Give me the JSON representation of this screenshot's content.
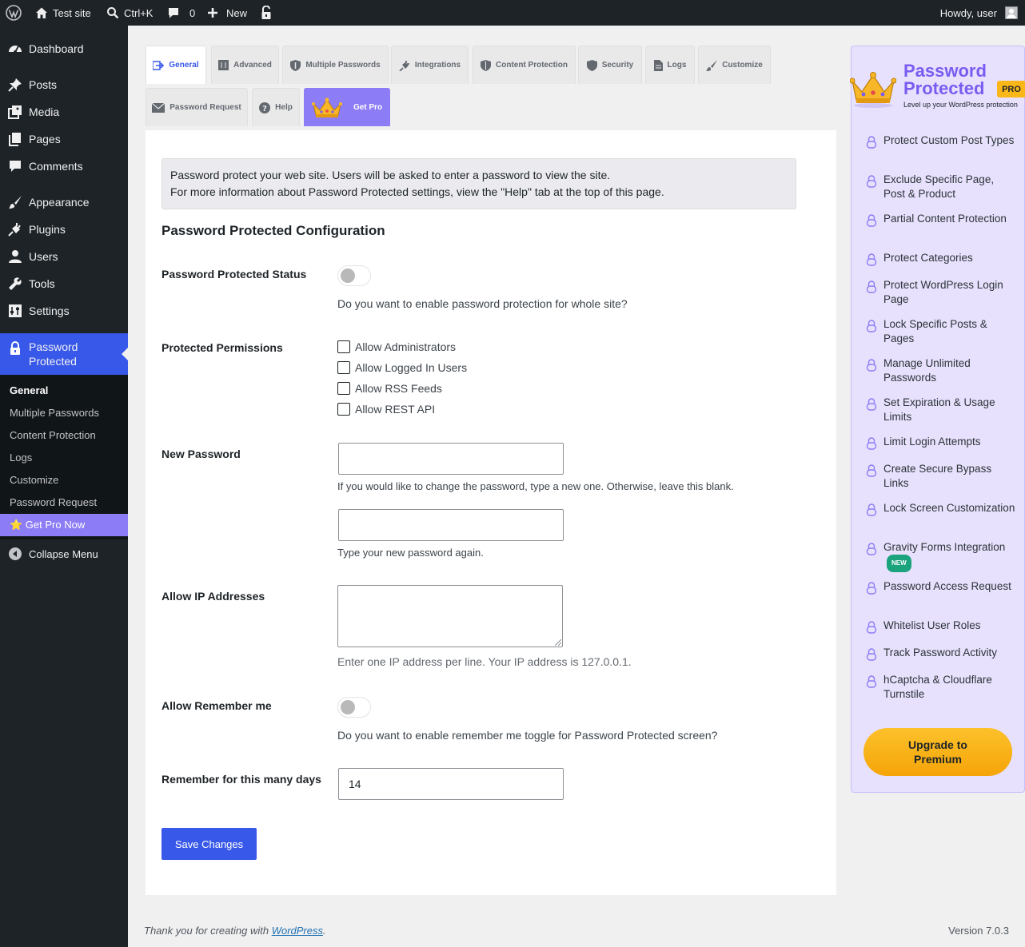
{
  "admin_bar": {
    "site_name": "Test site",
    "search_shortcut": "Ctrl+K",
    "comments_count": "0",
    "new_label": "New",
    "greeting": "Howdy, user"
  },
  "sidebar": {
    "items": [
      {
        "label": "Dashboard",
        "icon": "dashboard-icon"
      },
      {
        "label": "Posts",
        "icon": "pin-icon"
      },
      {
        "label": "Media",
        "icon": "media-icon"
      },
      {
        "label": "Pages",
        "icon": "pages-icon"
      },
      {
        "label": "Comments",
        "icon": "comment-icon"
      },
      {
        "label": "Appearance",
        "icon": "brush-icon"
      },
      {
        "label": "Plugins",
        "icon": "plug-icon"
      },
      {
        "label": "Users",
        "icon": "user-icon"
      },
      {
        "label": "Tools",
        "icon": "wrench-icon"
      },
      {
        "label": "Settings",
        "icon": "settings-icon"
      }
    ],
    "active_item": {
      "label_line1": "Password",
      "label_line2": "Protected",
      "icon": "lock-icon"
    },
    "submenu": [
      "General",
      "Multiple Passwords",
      "Content Protection",
      "Logs",
      "Customize",
      "Password Request"
    ],
    "get_pro": "⭐ Get Pro Now",
    "collapse": "Collapse Menu"
  },
  "tabs": {
    "row1": [
      "General",
      "Advanced",
      "Multiple Passwords",
      "Integrations",
      "Content Protection",
      "Security",
      "Logs",
      "Customize"
    ],
    "row2": [
      "Password Request",
      "Help",
      "Get Pro"
    ]
  },
  "notice": {
    "line1": "Password protect your web site. Users will be asked to enter a password to view the site.",
    "line2": "For more information about Password Protected settings, view the \"Help\" tab at the top of this page."
  },
  "config": {
    "heading": "Password Protected Configuration",
    "status_label": "Password Protected Status",
    "status_desc": "Do you want to enable password protection for whole site?",
    "permissions_label": "Protected Permissions",
    "permissions": [
      "Allow Administrators",
      "Allow Logged In Users",
      "Allow RSS Feeds",
      "Allow REST API"
    ],
    "new_password_label": "New Password",
    "new_password_desc": "If you would like to change the password, type a new one. Otherwise, leave this blank.",
    "confirm_password_desc": "Type your new password again.",
    "ip_label": "Allow IP Addresses",
    "ip_desc": "Enter one IP address per line. Your IP address is 127.0.0.1.",
    "remember_label": "Allow Remember me",
    "remember_desc": "Do you want to enable remember me toggle for Password Protected screen?",
    "days_label": "Remember for this many days",
    "days_value": "14",
    "save_label": "Save Changes"
  },
  "promo": {
    "title_line1": "Password",
    "title_line2": "Protected",
    "badge": "PRO",
    "subtitle": "Level up your WordPress protection",
    "features": [
      "Protect Custom Post Types",
      "Exclude Specific Page, Post & Product",
      "Partial Content Protection",
      "Protect Categories",
      "Protect WordPress Login Page",
      "Lock Specific Posts & Pages",
      "Manage Unlimited Passwords",
      "Set Expiration & Usage Limits",
      "Limit Login Attempts",
      "Create Secure Bypass Links",
      "Lock Screen Customization",
      "Gravity Forms Integration",
      "Password Access Request",
      "Whitelist User Roles",
      "Track Password Activity",
      "hCaptcha & Cloudflare Turnstile"
    ],
    "new_badge": "NEW",
    "upgrade_line1": "Upgrade to",
    "upgrade_line2": "Premium"
  },
  "footer": {
    "thanks_prefix": "Thank you for creating with ",
    "thanks_link": "WordPress",
    "thanks_suffix": ".",
    "version": "Version 7.0.3"
  }
}
